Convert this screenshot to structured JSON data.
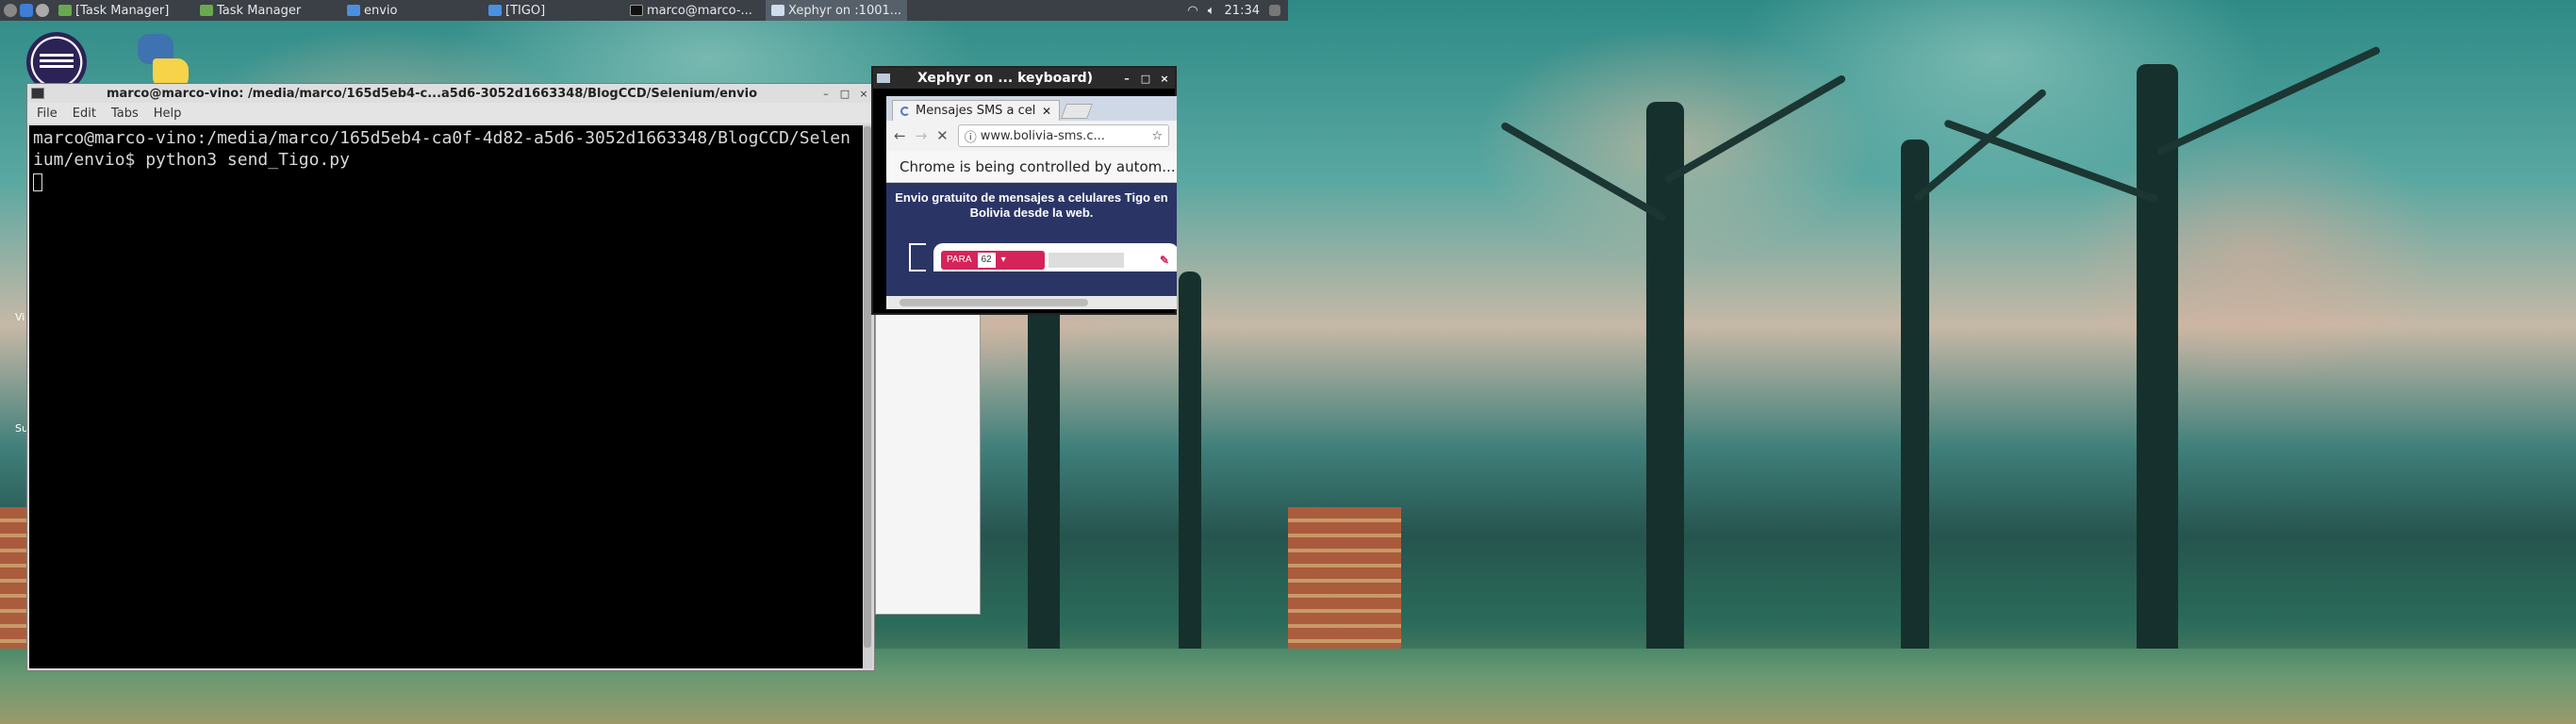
{
  "panel": {
    "tasks": [
      {
        "label": "[Task Manager]",
        "icon": "task-manager-icon"
      },
      {
        "label": "Task Manager",
        "icon": "task-manager-icon"
      },
      {
        "label": "envio",
        "icon": "folder-icon"
      },
      {
        "label": "[TIGO]",
        "icon": "folder-icon"
      },
      {
        "label": "marco@marco-...",
        "icon": "terminal-icon"
      },
      {
        "label": "Xephyr on :1001...",
        "icon": "xephyr-icon",
        "active": true
      }
    ],
    "clock": "21:34"
  },
  "desktop": {
    "side_labels": [
      "Vi",
      "Su"
    ]
  },
  "terminal": {
    "title": "marco@marco-vino: /media/marco/165d5eb4-c...a5d6-3052d1663348/BlogCCD/Selenium/envio",
    "menu": [
      "File",
      "Edit",
      "Tabs",
      "Help"
    ],
    "lines": [
      "marco@marco-vino:/media/marco/165d5eb4-ca0f-4d82-a5d6-3052d1663348/BlogCCD/Selen",
      "ium/envio$ python3 send_Tigo.py"
    ]
  },
  "xephyr": {
    "title": "Xephyr on ... keyboard)",
    "chrome": {
      "tab_title": "Mensajes SMS a cel",
      "url": "www.bolivia-sms.c...",
      "infobar": "Chrome is being controlled by autom...",
      "headline_1": "Envio gratuito de mensajes a celulares Tigo en",
      "headline_2": "Bolivia desde la web.",
      "form_label": "PARA",
      "form_code": "62"
    }
  },
  "colors": {
    "panel_bg": "#3b3f46",
    "terminal_bg": "#000000",
    "page_bg": "#2a3566",
    "accent_pink": "#d6245a"
  }
}
